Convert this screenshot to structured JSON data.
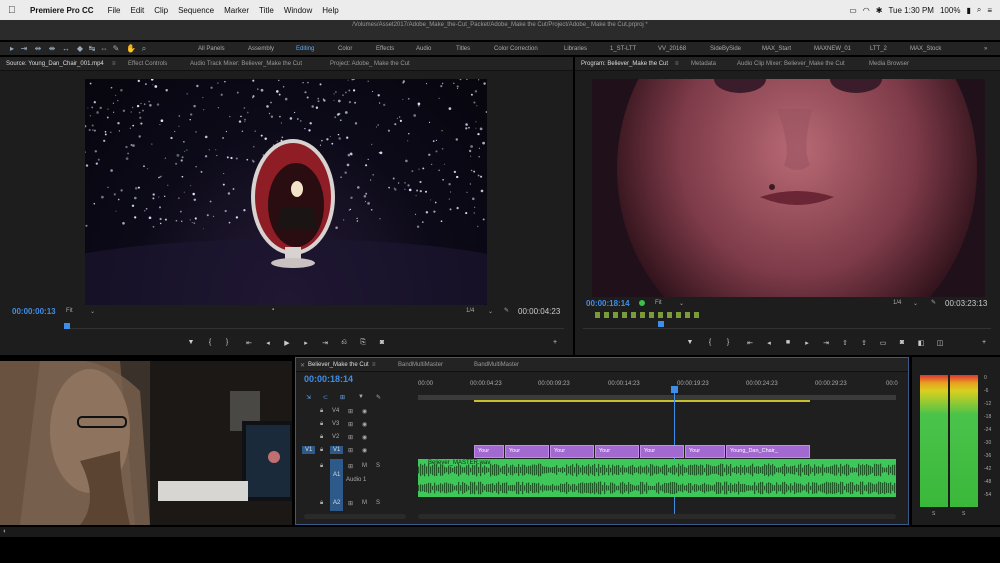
{
  "menubar": {
    "app": "Premiere Pro CC",
    "items": [
      "File",
      "Edit",
      "Clip",
      "Sequence",
      "Marker",
      "Title",
      "Window",
      "Help"
    ],
    "time": "Tue 1:30 PM",
    "battery": "100%"
  },
  "titlebar": {
    "path": "/Volumes/Asset2017/Adobe_Make_the-Cut_Packet/Adobe_Make the Cut/Project/Adobe_ Make the Cut.prproj *"
  },
  "workspaces": [
    "All Panels",
    "Assembly",
    "Editing",
    "Color",
    "Effects",
    "Audio",
    "Titles",
    "Color Correction",
    "Libraries",
    "1_ST-LTT",
    "VV_20168",
    "SideBySide",
    "MAX_Start",
    "MAXNEW_01",
    "LTT_2",
    "MAX_Stock"
  ],
  "active_workspace": "Editing",
  "source": {
    "tabs": [
      "Source: Young_Dan_Chair_001.mp4",
      "Effect Controls",
      "Audio Track Mixer: Believer_Make the Cut",
      "Project: Adobe_ Make the Cut"
    ],
    "timecode": "00:00:00:13",
    "fit": "Fit",
    "resolution": "1/4",
    "duration": "00:00:04:23"
  },
  "program": {
    "tabs": [
      "Program: Believer_Make the Cut",
      "Metadata",
      "Audio Clip Mixer: Believer_Make the Cut",
      "Media Browser"
    ],
    "timecode": "00:00:18:14",
    "fit": "Fit",
    "resolution": "1/4",
    "duration": "00:03:23:13"
  },
  "timeline": {
    "tabs": [
      "Believer_Make the Cut",
      "BandMultiMaster",
      "BandMultiMaster"
    ],
    "timecode": "00:00:18:14",
    "ruler": [
      "00:00",
      "00:00:04:23",
      "00:00:09:23",
      "00:00:14:23",
      "00:00:19:23",
      "00:00:24:23",
      "00:00:29:23",
      "00:0"
    ],
    "tracks": [
      "V4",
      "V3",
      "V2",
      "V1",
      "A1",
      "A2"
    ],
    "v1_source": "V1",
    "a1_name": "Audio 1",
    "clips": [
      "Your",
      "Your",
      "Your",
      "Your",
      "Your",
      "Your",
      "Young_Dan_Chair_"
    ],
    "audio_clip": "Believer_MASTER.wav"
  },
  "meter": {
    "scale": [
      "0",
      "-6",
      "-12",
      "-18",
      "-24",
      "-30",
      "-36",
      "-42",
      "-48",
      "-54"
    ],
    "bottom": [
      "S",
      "S"
    ]
  },
  "colors": {
    "accent": "#3e8ee8",
    "video_clip": "#a26ad0",
    "audio_clip": "#3ec85a",
    "marker": "#7b9b3a"
  }
}
